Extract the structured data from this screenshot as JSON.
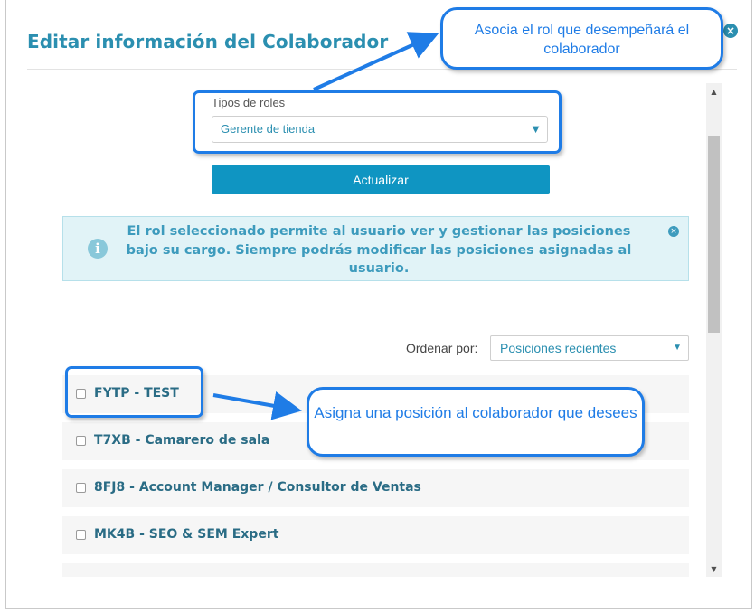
{
  "dialog": {
    "title": "Editar información del Colaborador",
    "close_glyph": "×"
  },
  "roles": {
    "label": "Tipos de roles",
    "selected": "Gerente de tienda",
    "caret": "▼"
  },
  "update_button": "Actualizar",
  "info": {
    "icon": "i",
    "text": "El rol seleccionado permite al usuario ver y gestionar las posiciones bajo su cargo. Siempre podrás modificar las posiciones asignadas al usuario.",
    "close_glyph": "×"
  },
  "sort": {
    "label": "Ordenar por:",
    "selected": "Posiciones recientes",
    "caret": "▼"
  },
  "positions": [
    {
      "label": "FYTP - TEST"
    },
    {
      "label": "T7XB - Camarero de sala"
    },
    {
      "label": "8FJ8 - Account Manager / Consultor de Ventas"
    },
    {
      "label": "MK4B - SEO & SEM Expert"
    }
  ],
  "scrollbar": {
    "up": "▲",
    "down": "▼"
  },
  "annotations": {
    "top": "Asocia el rol que desempeñará el colaborador",
    "middle": "Asigna una posición al colaborador que desees",
    "color": "#1f7ce6"
  },
  "colors": {
    "title": "#2b8fb0",
    "button": "#0f95c2",
    "info_bg": "#e1f3f7",
    "info_text": "#3d9bbd",
    "position_text": "#2a6c85"
  }
}
